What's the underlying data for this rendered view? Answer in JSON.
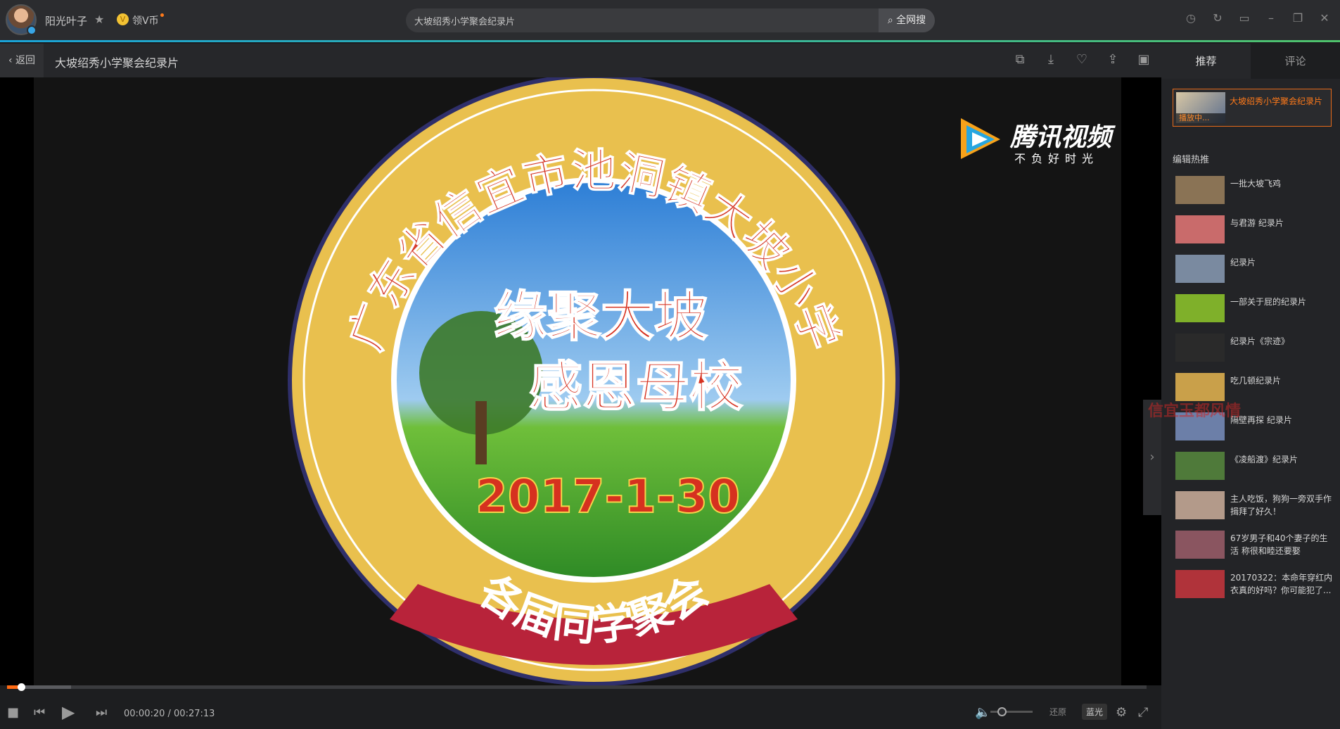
{
  "header": {
    "username": "阳光叶子",
    "coin_label": "领V币",
    "search_value": "大坡绍秀小学聚会纪录片",
    "search_button": "全网搜"
  },
  "titlebar": {
    "back_label": "返回",
    "video_title": "大坡绍秀小学聚会纪录片"
  },
  "video": {
    "emblem_ring_text": "广东省信宜市池洞镇大坡小学",
    "line1": "缘聚大坡",
    "line2": "感恩母校",
    "date": "2017-1-30",
    "ribbon": "各届同学聚会",
    "logo_brand": "腾讯视频",
    "logo_slogan": "不负好时光"
  },
  "controls": {
    "current_time": "00:00:20",
    "total_time": "00:27:13",
    "progress_fraction": 0.0122,
    "buffer_fraction": 0.056,
    "quality_options": [
      "还原",
      "蓝光"
    ],
    "time_display": "00:00:20 / 00:27:13"
  },
  "sidebar": {
    "tabs": [
      "推荐",
      "评论"
    ],
    "now_playing_title": "大坡绍秀小学聚会纪录片",
    "now_playing_badge": "播放中...",
    "section_title": "编辑热推",
    "items": [
      {
        "label": "一批大坡飞鸡"
      },
      {
        "label": "与君游 纪录片"
      },
      {
        "label": "纪录片"
      },
      {
        "label": "一部关于屁的纪录片"
      },
      {
        "label": "纪录片《宗迹》"
      },
      {
        "label": "吃几顿纪录片"
      },
      {
        "label": "隔壁再探 纪录片"
      },
      {
        "label": "《凌船渡》纪录片"
      },
      {
        "label": "主人吃饭，狗狗一旁双手作揖拜了好久！"
      },
      {
        "label": "67岁男子和40个妻子的生活 称很和睦还要娶"
      },
      {
        "label": "20170322：本命年穿红内衣真的好吗？你可能犯了..."
      }
    ],
    "watermark": "信宜玉都风情"
  },
  "colors": {
    "accent": "#ff6a13",
    "emblem_gold": "#e9c04e",
    "emblem_red": "#d63a2a",
    "ribbon_red": "#b8233a"
  }
}
